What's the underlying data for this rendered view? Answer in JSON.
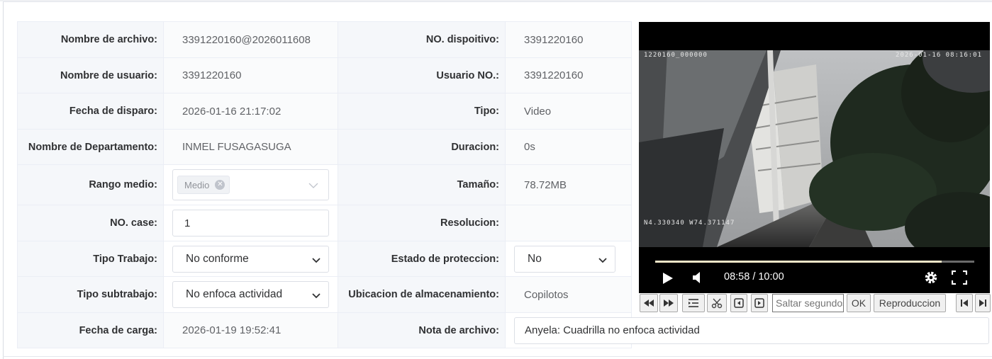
{
  "info": {
    "rows": [
      {
        "l_label": "Nombre de archivo:",
        "l_value": "3391220160@2026011608",
        "r_label": "NO. dispoitivo:",
        "r_value": "3391220160"
      },
      {
        "l_label": "Nombre de usuario:",
        "l_value": "3391220160",
        "r_label": "Usuario NO.:",
        "r_value": "3391220160"
      },
      {
        "l_label": "Fecha de disparo:",
        "l_value": "2026-01-16 21:17:02",
        "r_label": "Tipo:",
        "r_value": "Video"
      },
      {
        "l_label": "Nombre de Departamento:",
        "l_value": "INMEL FUSAGASUGA",
        "r_label": "Duracion:",
        "r_value": "0s"
      },
      {
        "l_label": "Rango medio:",
        "l_tag": "Medio",
        "r_label": "Tamaño:",
        "r_value": "78.72MB"
      },
      {
        "l_label": "NO. case:",
        "l_input": "1",
        "r_label": "Resolucion:",
        "r_value": ""
      },
      {
        "l_label": "Tipo Trabajo:",
        "l_select": "No conforme",
        "r_label": "Estado de proteccion:",
        "r_select": "No"
      },
      {
        "l_label": "Tipo subtrabajo:",
        "l_select": "No enfoca actividad",
        "r_label": "Ubicacion de almacenamiento:",
        "r_value": "Copilotos"
      },
      {
        "l_label": "Fecha de carga:",
        "l_value": "2026-01-19 19:52:41",
        "r_label": "Nota de archivo:",
        "r_input": "Anyela: Cuadrilla no enfoca actividad"
      }
    ]
  },
  "video": {
    "osd_top_left": "1220160_000000",
    "osd_top_right": "2026-01-16 08:16:01",
    "osd_gps": "N4.330340 W74.371147",
    "time_display": "08:58 / 10:00",
    "progress_fraction": 0.897
  },
  "toolbar": {
    "seek_placeholder": "Saltar segundos",
    "ok_label": "OK",
    "playback_label": "Reproduccion"
  }
}
